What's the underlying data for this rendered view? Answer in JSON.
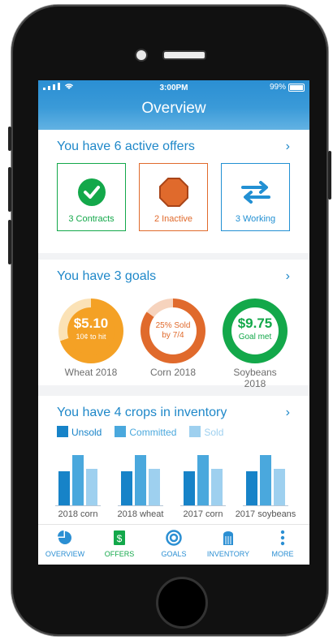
{
  "status_bar": {
    "time": "3:00PM",
    "battery": "99%"
  },
  "header": {
    "title": "Overview"
  },
  "offers": {
    "heading": "You have 6 active offers",
    "items": [
      {
        "label": "3 Contracts",
        "icon": "check-circle-icon",
        "color": "#13a84a"
      },
      {
        "label": "2 Inactive",
        "icon": "stop-octagon-icon",
        "color": "#e06a2c"
      },
      {
        "label": "3 Working",
        "icon": "swap-arrows-icon",
        "color": "#2290d3"
      }
    ]
  },
  "goals": {
    "heading": "You have 3 goals",
    "items": [
      {
        "value": "$5.10",
        "sub": "10¢ to hit",
        "name": "Wheat 2018",
        "color": "#f4a125",
        "progress": 0.7
      },
      {
        "value": "25% Sold",
        "sub": "by 7/4",
        "name": "Corn 2018",
        "color": "#e06a2c",
        "progress": 0.85
      },
      {
        "value": "$9.75",
        "sub": "Goal met",
        "name": "Soybeans 2018",
        "color": "#13a84a",
        "progress": 1.0
      }
    ]
  },
  "inventory": {
    "heading": "You have 4 crops in inventory",
    "legend": [
      "Unsold",
      "Committed",
      "Sold"
    ],
    "colors": [
      "#1783c8",
      "#4aa8dd",
      "#9ed0ef"
    ],
    "crops": [
      {
        "name": "2018 corn",
        "values": [
          0.67,
          1.0,
          0.73
        ]
      },
      {
        "name": "2018 wheat",
        "values": [
          0.67,
          1.0,
          0.73
        ]
      },
      {
        "name": "2017 corn",
        "values": [
          0.67,
          1.0,
          0.73
        ]
      },
      {
        "name": "2017 soybeans",
        "values": [
          0.67,
          1.0,
          0.73
        ]
      }
    ]
  },
  "tabs": [
    {
      "label": "OVERVIEW",
      "icon": "pie-chart-icon",
      "active": false
    },
    {
      "label": "OFFERS",
      "icon": "dollar-document-icon",
      "active": true
    },
    {
      "label": "GOALS",
      "icon": "target-icon",
      "active": false
    },
    {
      "label": "INVENTORY",
      "icon": "silo-icon",
      "active": false
    },
    {
      "label": "MORE",
      "icon": "more-dots-icon",
      "active": false
    }
  ]
}
